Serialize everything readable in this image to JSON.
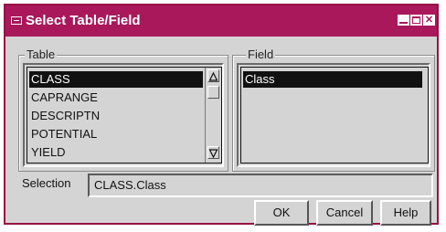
{
  "window": {
    "title": "Select Table/Field",
    "menu_icon": "window-menu-icon",
    "controls": [
      "minimize-icon",
      "maximize-icon",
      "close-icon"
    ],
    "close_glyph": "✕",
    "colors": {
      "titlebar": "#a8185a",
      "face": "#d4d4d4",
      "selection": "#111111"
    }
  },
  "table_group": {
    "label": "Table",
    "items": [
      "CLASS",
      "CAPRANGE",
      "DESCRIPTN",
      "POTENTIAL",
      "YIELD"
    ],
    "selected_index": 0
  },
  "field_group": {
    "label": "Field",
    "items": [
      "Class"
    ],
    "selected_index": 0
  },
  "selection": {
    "label": "Selection",
    "value": "CLASS.Class"
  },
  "buttons": {
    "ok": "OK",
    "cancel": "Cancel",
    "help": "Help"
  }
}
